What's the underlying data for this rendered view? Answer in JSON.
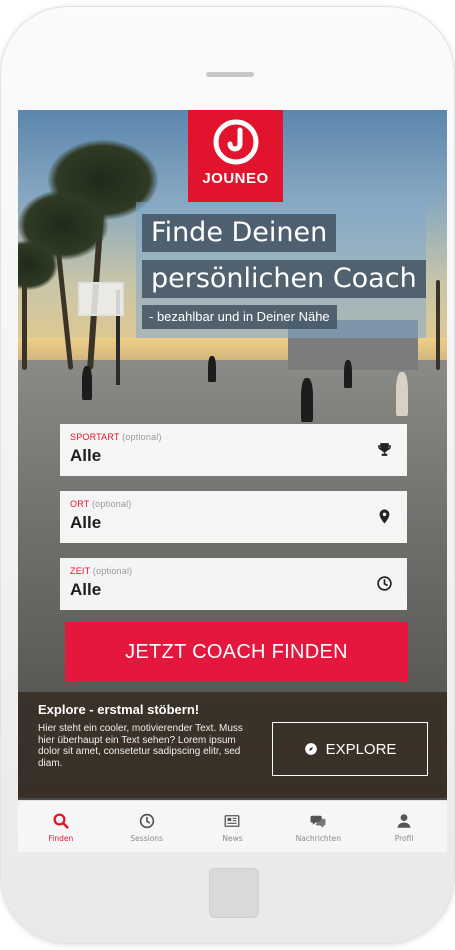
{
  "brand": {
    "name": "JOUNEO",
    "color": "#e2142d"
  },
  "hero": {
    "headline_1": "Finde Deinen",
    "headline_2": "persönlichen Coach",
    "subline": "- bezahlbar und in Deiner Nähe"
  },
  "search": {
    "fields": [
      {
        "label": "SPORTART",
        "optional": "(optional)",
        "value": "Alle",
        "icon": "trophy-icon"
      },
      {
        "label": "ORT",
        "optional": "(optional)",
        "value": "Alle",
        "icon": "map-marker-icon"
      },
      {
        "label": "ZEIT",
        "optional": "(optional)",
        "value": "Alle",
        "icon": "clock-icon"
      }
    ],
    "cta_label": "JETZT COACH FINDEN",
    "cta_color": "#e5173f"
  },
  "explore": {
    "title": "Explore - erstmal stöbern!",
    "text": "Hier steht ein cooler, motivierender Text. Muss hier überhaupt ein Text sehen? Lorem ipsum dolor sit amet, consetetur sadipscing elitr, sed diam.",
    "button_label": "EXPLORE",
    "button_icon": "compass-icon"
  },
  "tabbar": {
    "items": [
      {
        "label": "Finden",
        "icon": "search-icon",
        "active": true
      },
      {
        "label": "Sessions",
        "icon": "clock-icon",
        "active": false
      },
      {
        "label": "News",
        "icon": "newspaper-icon",
        "active": false
      },
      {
        "label": "Nachrichten",
        "icon": "chat-icon",
        "active": false
      },
      {
        "label": "Profil",
        "icon": "user-icon",
        "active": false
      }
    ]
  }
}
